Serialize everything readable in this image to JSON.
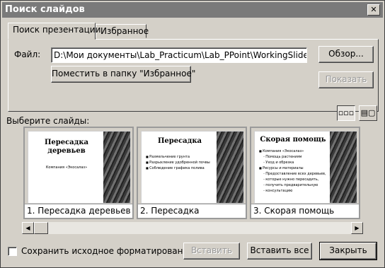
{
  "window": {
    "title": "Поиск слайдов",
    "close_label": "✕"
  },
  "tabs": [
    {
      "label": "Поиск презентации"
    },
    {
      "label": "Избранное"
    }
  ],
  "file": {
    "label": "Файл:",
    "value": "D:\\Мои документы\\Lab_Practicum\\Lab_PPoint\\WorkingSlide\\Insert",
    "browse_label": "Обзор...",
    "add_favorite_label": "Поместить в папку \"Избранное\"",
    "show_label": "Показать"
  },
  "slides_section": {
    "label": "Выберите слайды:",
    "view_list_icon": "▫▫▫",
    "view_detail_icon": "▤▢"
  },
  "slides": [
    {
      "caption": "1. Пересадка деревьев",
      "title": "Пересадка деревьев",
      "subtitle": "Компания «Экосалаз»",
      "bullets": []
    },
    {
      "caption": "2. Пересадка",
      "title": "Пересадка",
      "subtitle": "",
      "bullets": [
        "Размельчение грунта",
        "Разрыхление удобренной почвы",
        "Соблюдение графика полива"
      ]
    },
    {
      "caption": "3. Скорая помощь",
      "title": "Скорая помощь",
      "subtitle": "",
      "bullets": [
        "Компания «Экосалаз»",
        "Помощь растениям",
        "Уход и обрезка",
        "Ресурсы и материалы",
        "Предоставление всех деревьев,",
        "которые нужно пересадить,",
        "получить предварительную",
        "консультацию"
      ]
    }
  ],
  "scrollbar": {
    "left_arrow": "◀",
    "right_arrow": "▶"
  },
  "footer": {
    "keep_format_label": "Сохранить исходное форматирование",
    "insert_label": "Вставить",
    "insert_all_label": "Вставить все",
    "close_label": "Закрыть"
  }
}
